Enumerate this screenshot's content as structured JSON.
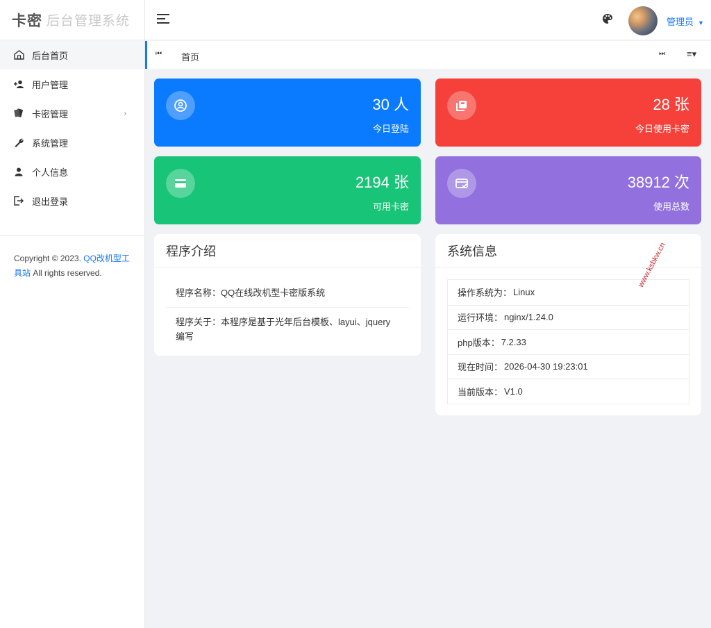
{
  "logo": {
    "main": "卡密",
    "sub": "后台管理系统"
  },
  "sidebar": {
    "items": [
      {
        "label": "后台首页",
        "icon": "home-icon"
      },
      {
        "label": "用户管理",
        "icon": "users-icon"
      },
      {
        "label": "卡密管理",
        "icon": "cards-icon",
        "arrow": "›"
      },
      {
        "label": "系统管理",
        "icon": "wrench-icon"
      },
      {
        "label": "个人信息",
        "icon": "person-icon"
      },
      {
        "label": "退出登录",
        "icon": "logout-icon"
      }
    ],
    "copyright": {
      "prefix": "Copyright © 2023. ",
      "link": "QQ改机型工具站",
      "suffix": " All rights reserved."
    }
  },
  "header": {
    "admin": "管理员",
    "caret": "▼"
  },
  "tabbar": {
    "prev": "⏮",
    "home": "首页",
    "next": "⏭",
    "menu": "≡▾"
  },
  "stats": [
    {
      "value": "30 人",
      "label": "今日登陆",
      "color": "#0a7aff",
      "icon": "user-circle-icon"
    },
    {
      "value": "28 张",
      "label": "今日使用卡密",
      "color": "#f5413a",
      "icon": "card-stack-icon"
    },
    {
      "value": "2194 张",
      "label": "可用卡密",
      "color": "#18c578",
      "icon": "card-icon"
    },
    {
      "value": "38912 次",
      "label": "使用总数",
      "color": "#9271df",
      "icon": "card-check-icon"
    }
  ],
  "intro": {
    "title": "程序介绍",
    "rows": [
      "程序名称：QQ在线改机型卡密版系统",
      "程序关于：本程序是基于光年后台模板、layui、jquery编写"
    ]
  },
  "sysinfo": {
    "title": "系统信息",
    "rows": [
      {
        "k": "操作系统为：",
        "v": "Linux"
      },
      {
        "k": "运行环境：",
        "v": "nginx/1.24.0"
      },
      {
        "k": "php版本：",
        "v": "7.2.33"
      },
      {
        "k": "现在时间：",
        "v": "2026-04-30 19:23:01"
      },
      {
        "k": "当前版本：",
        "v": "V1.0"
      }
    ]
  },
  "watermark": "www.ksbkw.cn"
}
